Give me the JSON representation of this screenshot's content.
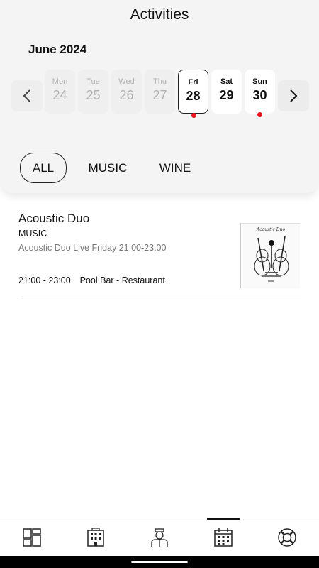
{
  "header": {
    "title": "Activities",
    "month": "June 2024"
  },
  "icons": {
    "prev": "chevron-left-icon",
    "next": "chevron-right-icon"
  },
  "days": [
    {
      "name": "Mon",
      "num": "24",
      "active": false,
      "selected": false,
      "has_event": false
    },
    {
      "name": "Tue",
      "num": "25",
      "active": false,
      "selected": false,
      "has_event": false
    },
    {
      "name": "Wed",
      "num": "26",
      "active": false,
      "selected": false,
      "has_event": false
    },
    {
      "name": "Thu",
      "num": "27",
      "active": false,
      "selected": false,
      "has_event": false
    },
    {
      "name": "Fri",
      "num": "28",
      "active": true,
      "selected": true,
      "has_event": true
    },
    {
      "name": "Sat",
      "num": "29",
      "active": true,
      "selected": false,
      "has_event": false
    },
    {
      "name": "Sun",
      "num": "30",
      "active": true,
      "selected": false,
      "has_event": true
    }
  ],
  "filters": [
    {
      "label": "ALL",
      "selected": true
    },
    {
      "label": "MUSIC",
      "selected": false
    },
    {
      "label": "WINE",
      "selected": false
    }
  ],
  "activities": [
    {
      "title": "Acoustic Duo",
      "category": "MUSIC",
      "description": "Acoustic Duo Live Friday 21.00-23.00",
      "time": "21:00 - 23:00",
      "location": "Pool Bar - Restaurant",
      "thumbnail_text": "Acoustic Duo",
      "thumbnail_icon": "guitar-poster-icon"
    }
  ],
  "tabbar": {
    "items": [
      {
        "icon": "dashboard-icon",
        "active": false
      },
      {
        "icon": "hotel-building-icon",
        "active": false
      },
      {
        "icon": "concierge-icon",
        "active": false
      },
      {
        "icon": "calendar-icon",
        "active": true
      },
      {
        "icon": "lifebuoy-icon",
        "active": false
      }
    ]
  },
  "colors": {
    "event_dot": "#e4141c",
    "header_bg": "#f4f4f4",
    "inactive_text": "#b2b2b2"
  }
}
